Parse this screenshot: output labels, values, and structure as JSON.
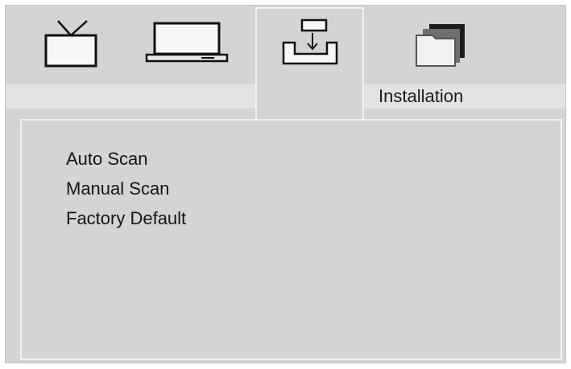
{
  "header": {
    "active_tab_title": "Installation"
  },
  "tabs": [
    {
      "icon": "tv-icon",
      "active": false
    },
    {
      "icon": "monitor-icon",
      "active": false
    },
    {
      "icon": "install-icon",
      "active": true
    },
    {
      "icon": "folders-icon",
      "active": false
    }
  ],
  "menu": {
    "items": [
      {
        "label": "Auto Scan"
      },
      {
        "label": "Manual Scan"
      },
      {
        "label": "Factory Default"
      }
    ]
  },
  "colors": {
    "background": "#d4d4d4",
    "highlight_strip": "#e3e3e3",
    "border_light": "#f2f2f2",
    "text": "#141414"
  }
}
